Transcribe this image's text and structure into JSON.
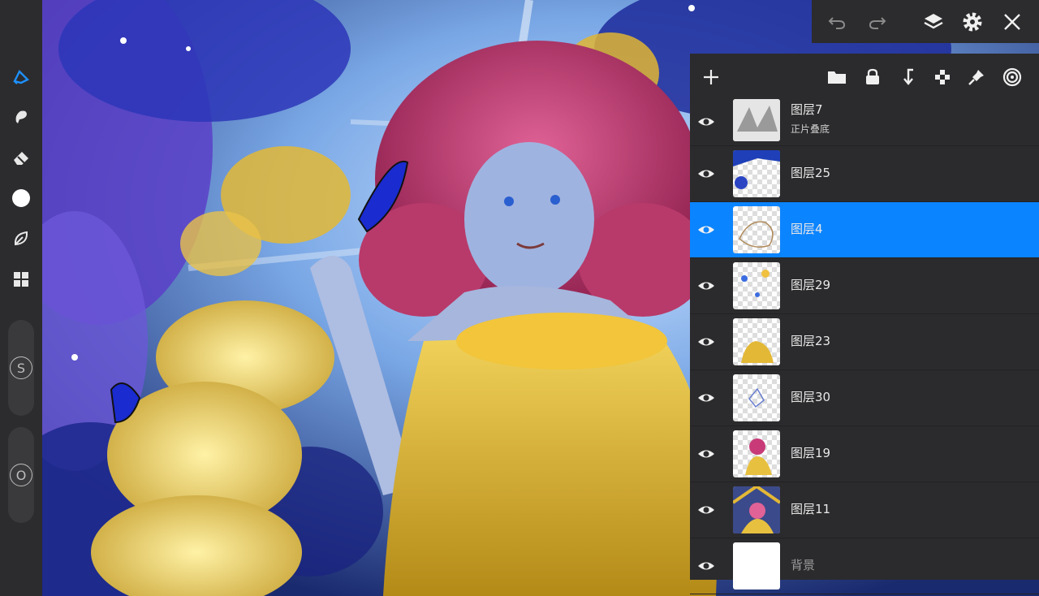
{
  "top_bar": {
    "icons": [
      "undo-icon",
      "redo-icon",
      "layers-icon",
      "gear-icon",
      "close-icon"
    ]
  },
  "left_toolbar": {
    "tools": [
      "brush-icon",
      "smudge-icon",
      "eraser-icon",
      "color-swatch",
      "leaf-icon",
      "grid-icon"
    ],
    "size_slider_label": "S",
    "opacity_slider_label": "O"
  },
  "layers_panel": {
    "toolbar_icons": [
      "add-icon",
      "folder-icon",
      "lock-icon",
      "merge-down-icon",
      "transparency-icon",
      "pin-icon",
      "target-icon"
    ],
    "layers": [
      {
        "name": "图层7",
        "blend": "正片叠底",
        "selected": false
      },
      {
        "name": "图层25",
        "selected": false
      },
      {
        "name": "图层4",
        "selected": true
      },
      {
        "name": "图层29",
        "selected": false
      },
      {
        "name": "图层23",
        "selected": false
      },
      {
        "name": "图层30",
        "selected": false
      },
      {
        "name": "图层19",
        "selected": false
      },
      {
        "name": "图层11",
        "selected": false
      },
      {
        "name": "背景",
        "selected": false
      }
    ]
  },
  "colors": {
    "accent": "#0b84ff",
    "panel": "#2b2b2d",
    "toolbar": "#2c2c2e"
  }
}
